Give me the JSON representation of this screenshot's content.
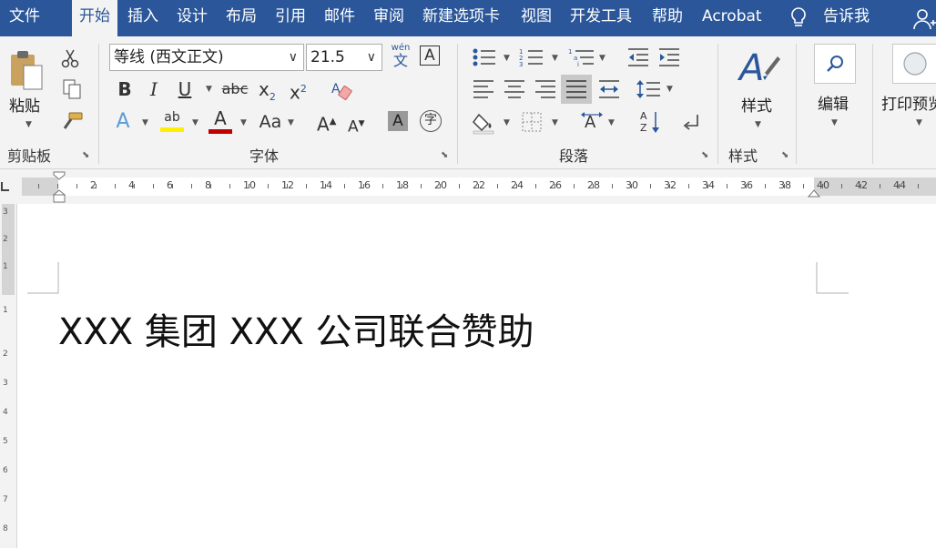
{
  "menu": {
    "tabs": [
      "文件",
      "开始",
      "插入",
      "设计",
      "布局",
      "引用",
      "邮件",
      "审阅",
      "新建选项卡",
      "视图",
      "开发工具",
      "帮助",
      "Acrobat"
    ],
    "active_tab": "开始",
    "tell_me": "告诉我"
  },
  "clipboard": {
    "paste_label": "粘贴",
    "group_label": "剪贴板"
  },
  "font": {
    "font_name": "等线 (西文正文)",
    "font_size": "21.5",
    "phonetic_pinyin": "wén",
    "phonetic_char": "文",
    "bold": "B",
    "italic": "I",
    "underline": "U",
    "strikethrough": "abc",
    "subscript": "x",
    "subscript_mark": "2",
    "superscript": "x",
    "superscript_mark": "2",
    "highlight": "ab",
    "font_color": "A",
    "change_case": "Aa",
    "grow_font": "A",
    "shrink_font": "A",
    "char_shading": "A",
    "enclose_char": "字",
    "group_label": "字体"
  },
  "paragraph": {
    "group_label": "段落"
  },
  "styles": {
    "button_label": "样式",
    "group_label": "样式"
  },
  "editing": {
    "button_label": "编辑"
  },
  "print_preview": {
    "button_label": "打印预览"
  },
  "ruler": {
    "numbers": [
      "2",
      "4",
      "6",
      "8",
      "10",
      "12",
      "14",
      "16",
      "18",
      "20",
      "22",
      "24",
      "26",
      "28",
      "30",
      "32",
      "34",
      "36",
      "38",
      "40",
      "42",
      "44"
    ],
    "vertical_numbers": [
      "3",
      "2",
      "1",
      "1",
      "2",
      "3",
      "4",
      "5",
      "6",
      "7",
      "8"
    ]
  },
  "document": {
    "text": "XXX 集团 XXX 公司联合赞助"
  },
  "colors": {
    "accent": "#2b579a",
    "highlight_yellow": "#ffef00",
    "font_red": "#c00000"
  }
}
